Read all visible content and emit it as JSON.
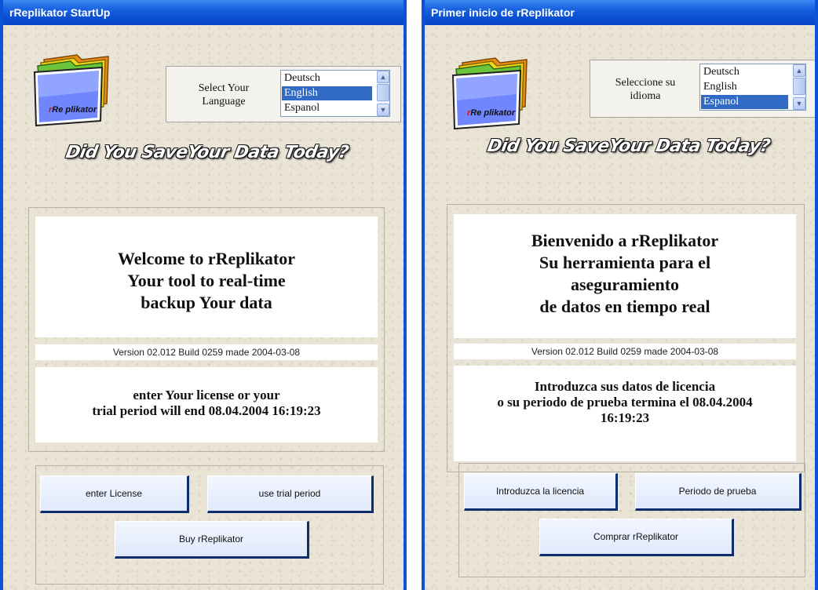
{
  "left_window": {
    "title": "rReplikator StartUp",
    "logo_text_r": "r",
    "logo_text_rest": "Re plikator",
    "language_label_line1": "Select Your",
    "language_label_line2": "Language",
    "languages": [
      "Deutsch",
      "English",
      "Espanol"
    ],
    "selected_language": "English",
    "slogan": "Did You SaveYour Data Today?",
    "welcome_line1": "Welcome to rReplikator",
    "welcome_line2": "Your tool to real-time",
    "welcome_line3": "backup Your data",
    "version": "Version  02.012  Build  0259  made  2004-03-08",
    "license_line1": "enter Your license or your",
    "license_line2": "trial period will end  08.04.2004 16:19:23",
    "buttons": {
      "enter_license": "enter License",
      "use_trial": "use trial period",
      "buy": "Buy rReplikator"
    }
  },
  "right_window": {
    "title": "Primer inicio de rReplikator",
    "logo_text_r": "r",
    "logo_text_rest": "Re plikator",
    "language_label_line1": "Seleccione su",
    "language_label_line2": "idioma",
    "languages": [
      "Deutsch",
      "English",
      "Espanol"
    ],
    "selected_language": "Espanol",
    "slogan": "Did You SaveYour Data Today?",
    "welcome_line1": "Bienvenido a rReplikator",
    "welcome_line2": "Su herramienta para el",
    "welcome_line3": "aseguramiento",
    "welcome_line4": "de datos en tiempo real",
    "version": "Version  02.012  Build  0259  made  2004-03-08",
    "license_line1": "Introduzca sus datos de licencia",
    "license_line2": "o su periodo de prueba termina el   08.04.2004",
    "license_line3": "16:19:23",
    "buttons": {
      "enter_license": "Introduzca la licencia",
      "use_trial": "Periodo de prueba",
      "buy": "Comprar rReplikator"
    }
  },
  "colors": {
    "titlebar_blue": "#0a52d8",
    "selection_blue": "#316ac5",
    "button_shadow": "#0e2d6b",
    "background_texture": "#e9e4d5"
  }
}
